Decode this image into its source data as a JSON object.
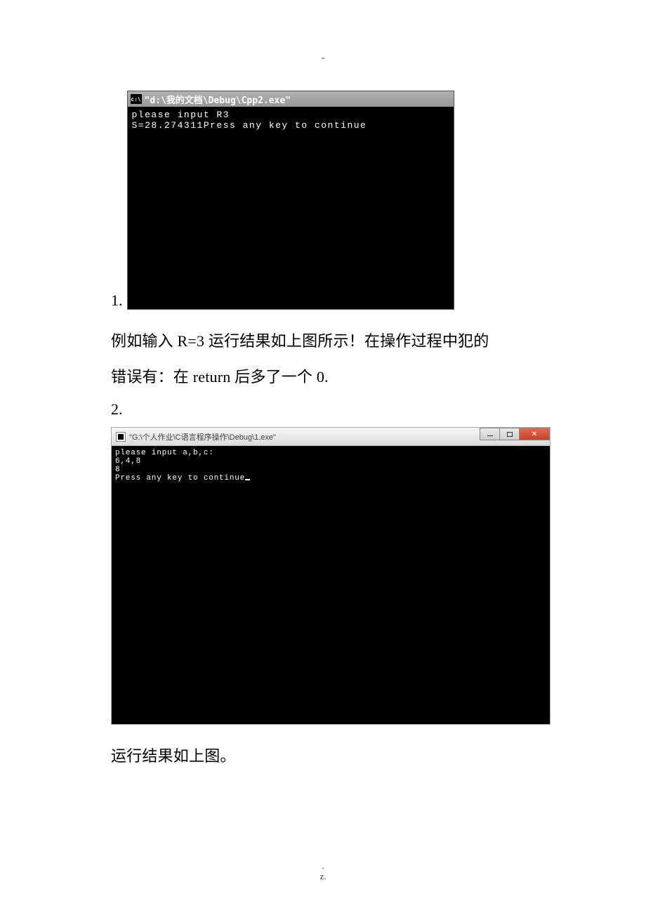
{
  "top_mark": "-",
  "item1": {
    "number": "1.",
    "title": "\"d:\\我的文档\\Debug\\Cpp2.exe\"",
    "icon_label": "c:\\",
    "line1": "please input R3",
    "line2": "S=28.274311Press any key to continue"
  },
  "para1_line1": "例如输入 R=3 运行结果如上图所示！在操作过程中犯的",
  "para1_line2": "错误有：在 return 后多了一个 0.",
  "item2": {
    "number": "2.",
    "title": "\"G:\\个人作业\\C语言程序操作\\Debug\\1.exe\"",
    "line1": "please input a,b,c:",
    "line2": "6,4,8",
    "line3": "8",
    "line4": "Press any key to continue"
  },
  "para2": "运行结果如上图。",
  "footer_dot": ".",
  "footer_z": "z."
}
